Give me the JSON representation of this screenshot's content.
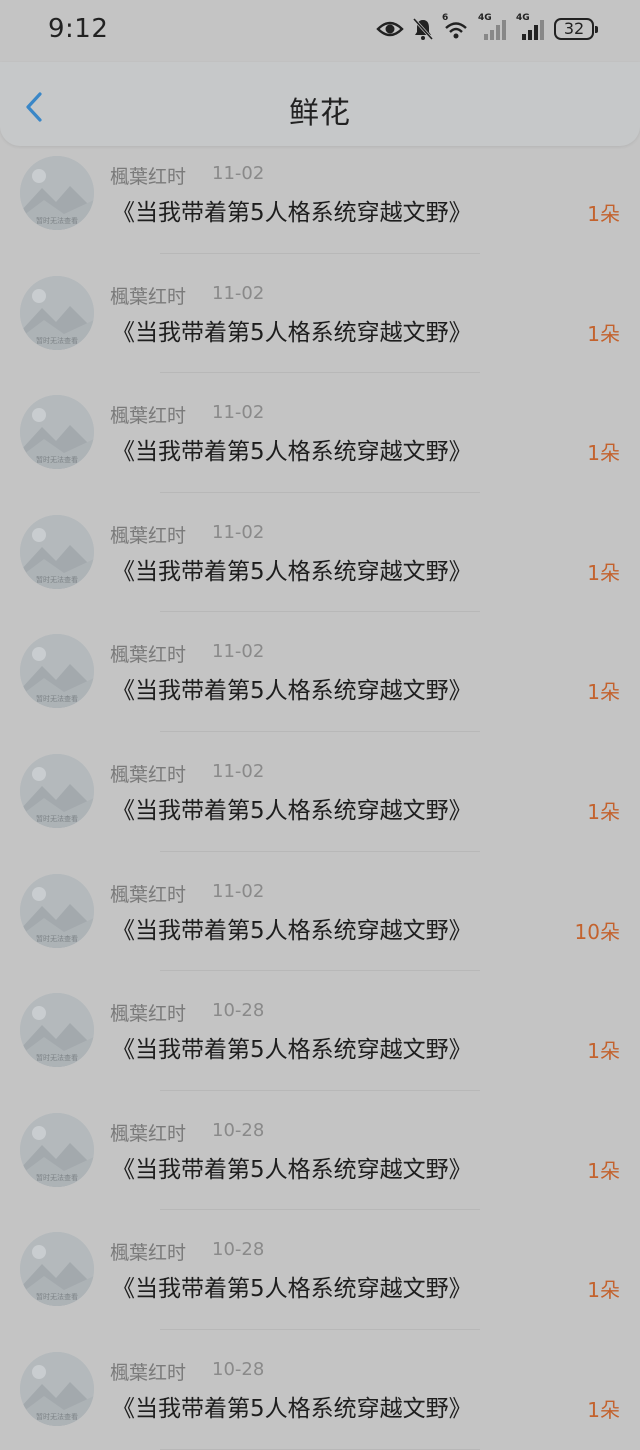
{
  "status": {
    "time": "9:12",
    "battery": "32",
    "sig1_label": "4G",
    "sig2_label": "4G",
    "wifi_label": "6"
  },
  "header": {
    "title": "鲜花"
  },
  "avatar_placeholder_text": "暂时无法查看",
  "items": [
    {
      "name": "楓葉红时",
      "date": "11-02",
      "book": "《当我带着第5人格系统穿越文野》",
      "amount": "1朵"
    },
    {
      "name": "楓葉红时",
      "date": "11-02",
      "book": "《当我带着第5人格系统穿越文野》",
      "amount": "1朵"
    },
    {
      "name": "楓葉红时",
      "date": "11-02",
      "book": "《当我带着第5人格系统穿越文野》",
      "amount": "1朵"
    },
    {
      "name": "楓葉红时",
      "date": "11-02",
      "book": "《当我带着第5人格系统穿越文野》",
      "amount": "1朵"
    },
    {
      "name": "楓葉红时",
      "date": "11-02",
      "book": "《当我带着第5人格系统穿越文野》",
      "amount": "1朵"
    },
    {
      "name": "楓葉红时",
      "date": "11-02",
      "book": "《当我带着第5人格系统穿越文野》",
      "amount": "1朵"
    },
    {
      "name": "楓葉红时",
      "date": "11-02",
      "book": "《当我带着第5人格系统穿越文野》",
      "amount": "10朵"
    },
    {
      "name": "楓葉红时",
      "date": "10-28",
      "book": "《当我带着第5人格系统穿越文野》",
      "amount": "1朵"
    },
    {
      "name": "楓葉红时",
      "date": "10-28",
      "book": "《当我带着第5人格系统穿越文野》",
      "amount": "1朵"
    },
    {
      "name": "楓葉红时",
      "date": "10-28",
      "book": "《当我带着第5人格系统穿越文野》",
      "amount": "1朵"
    },
    {
      "name": "楓葉红时",
      "date": "10-28",
      "book": "《当我带着第5人格系统穿越文野》",
      "amount": "1朵"
    }
  ],
  "colors": {
    "overlay_background": "#c4c4c4",
    "amount": "#c3622d",
    "back_arrow": "#3a87c7"
  }
}
